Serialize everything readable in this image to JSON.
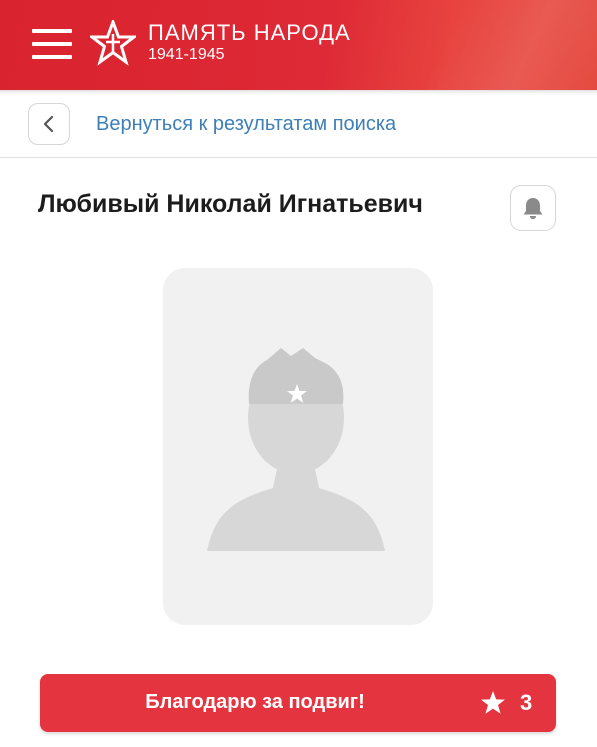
{
  "header": {
    "title": "ПАМЯТЬ НАРОДА",
    "years": "1941-1945",
    "colors": {
      "background": "#d9232f",
      "text": "#ffffff"
    },
    "menu_icon": "hamburger-menu-icon",
    "logo_icon": "star-logo-icon"
  },
  "backbar": {
    "back_icon": "chevron-left-icon",
    "back_link": "Вернуться к результатам поиска",
    "link_color": "#3d7fb6"
  },
  "person": {
    "name": "Любивый Николай Игнатьевич",
    "subscribe_icon": "bell-icon",
    "photo_placeholder_icon": "soldier-silhouette-icon"
  },
  "actions": {
    "thanks_label": "Благодарю за подвиг!",
    "thanks_icon": "star-icon",
    "thanks_count": "3",
    "button_color": "#e4343f"
  }
}
